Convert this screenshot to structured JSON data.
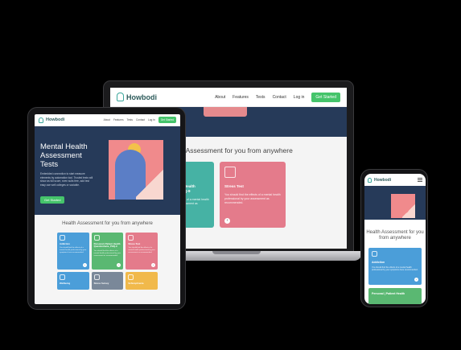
{
  "brand": {
    "name": "Howbodi"
  },
  "nav": {
    "links": [
      "About",
      "Features",
      "Tests",
      "Contact",
      "Log in"
    ],
    "cta": "Get Started"
  },
  "hero": {
    "title": "Mental Health Assessment Tests",
    "text": "Embedded connection to start measure elements by automation tool. Trusted tests will show as full score, even suits free, add test easy use well colleges or sociable.",
    "cta": "Get Started"
  },
  "section": {
    "title_laptop": "Health Assessment for you from anywhere",
    "title_tablet": "Health Assessment for you from anywhere",
    "title_phone": "Health Assessment for you from anywhere"
  },
  "cards": [
    {
      "title": "Addiction",
      "desc": "You should find the effects of a mental health professional by your symptoms here recommended.",
      "color": "#4b9ed9"
    },
    {
      "title": "Personal | Patient Health Questionnaire_PHQ-9",
      "desc": "You should find the effects of a mental health professional by your assessment as recommended.",
      "color": "#46b2a4"
    },
    {
      "title": "Stress Test",
      "desc": "You should find the effects of a mental health professional by your assessment as recommended.",
      "color": "#e47b8b"
    },
    {
      "title": "Wellbeing",
      "desc": "",
      "color": "#7a8899"
    },
    {
      "title": "Stress Survey",
      "desc": "",
      "color": "#7a8899"
    },
    {
      "title": "Schizophrenia",
      "desc": "",
      "color": "#f1b94b"
    }
  ],
  "phone_cards": [
    {
      "title": "Addiction",
      "desc": "You should find the effects of a mental health professional by your symptoms here recommended."
    },
    {
      "title": "Personal | Patient Health"
    }
  ],
  "arrow": "›",
  "colors": {
    "navy": "#263a59",
    "green": "#45c46b",
    "pink": "#f08a8c"
  }
}
